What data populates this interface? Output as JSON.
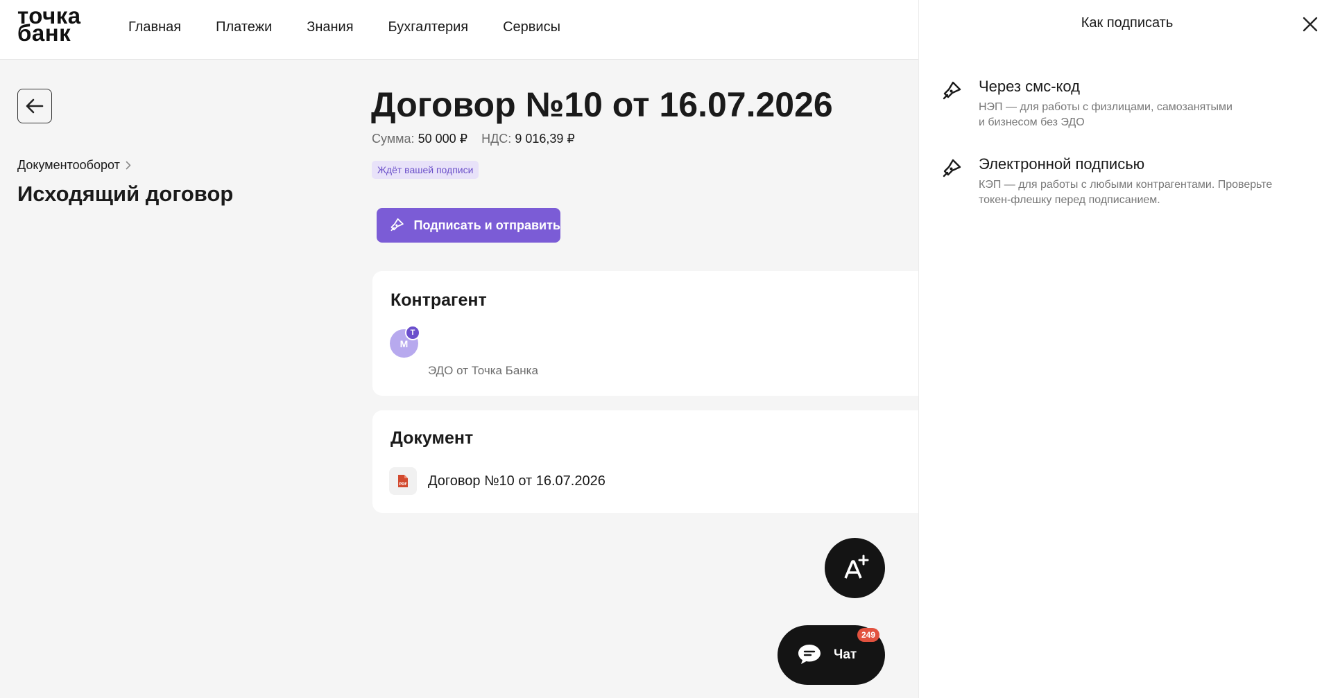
{
  "header": {
    "logo_line1": "точка",
    "logo_line2": "банк",
    "nav": [
      "Главная",
      "Платежи",
      "Знания",
      "Бухгалтерия",
      "Сервисы"
    ]
  },
  "left": {
    "breadcrumb": "Документооборот",
    "title": "Исходящий договор"
  },
  "document": {
    "title": "Договор №10 от 16.07.2026",
    "sum_label": "Сумма:",
    "sum_value": "50 000 ₽",
    "vat_label": "НДС:",
    "vat_value": "9 016,39 ₽",
    "status": "Ждёт вашей подписи",
    "sign_button": "Подписать и отправить"
  },
  "contragent_card": {
    "title": "Контрагент",
    "avatar_letter": "M",
    "avatar_badge": "T",
    "subtitle": "ЭДО от Точка Банка"
  },
  "document_card": {
    "title": "Документ",
    "file_type": "PDF",
    "file_name": "Договор №10 от 16.07.2026"
  },
  "floating": {
    "chat_label": "Чат",
    "chat_count": "249"
  },
  "panel": {
    "title": "Как подписать",
    "options": [
      {
        "title": "Через смс-код",
        "desc_line1": "НЭП — для работы с физлицами, самозанятыми",
        "desc_line2": "и бизнесом без ЭДО"
      },
      {
        "title": "Электронной подписью",
        "desc_line1": "КЭП — для работы с любыми контрагентами. Проверьте",
        "desc_line2": "токен-флешку перед подписанием."
      }
    ]
  },
  "colors": {
    "accent": "#7b5cd6",
    "badge_bg": "#e8e2f9",
    "badge_text": "#6b50c9",
    "page_bg": "#f5f5f5",
    "chat_counter": "#e2523f"
  },
  "icons": [
    "arrow-left-icon",
    "chevron-right-icon",
    "pen-icon",
    "pdf-file-icon",
    "ai-sparkle-icon",
    "chat-bubble-icon",
    "close-icon"
  ]
}
